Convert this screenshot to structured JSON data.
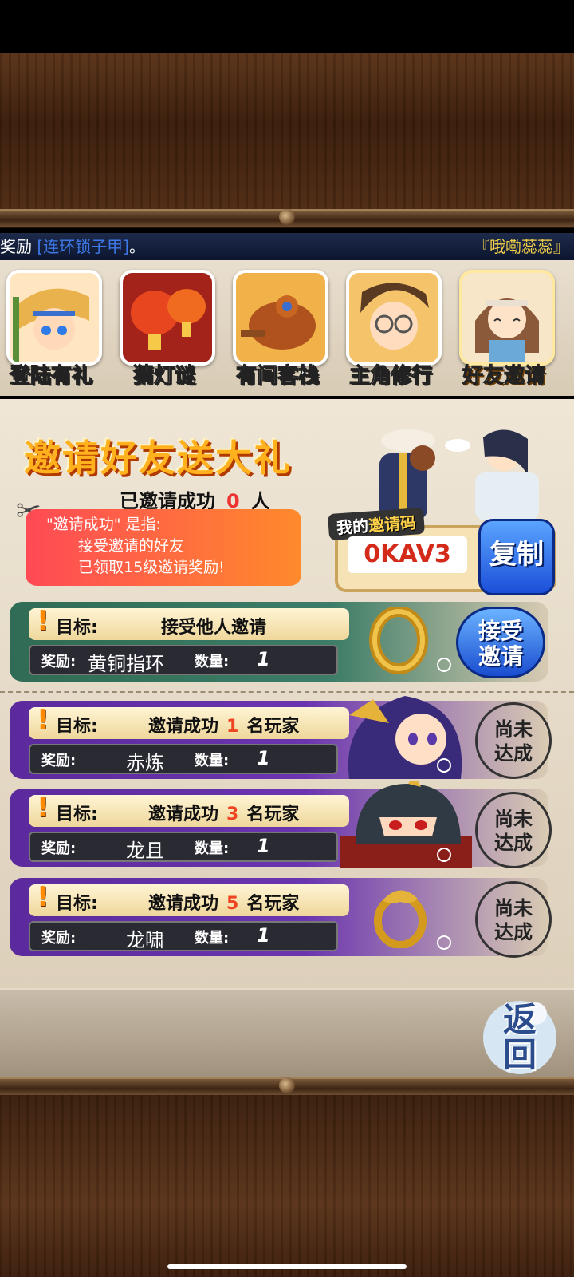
{
  "ticker": {
    "left": "奖励",
    "item": "[连环锁子甲]",
    "end": "。",
    "right": "『哦嘞蕊蕊』"
  },
  "tabs": [
    {
      "label": "登陆有礼",
      "icon": "hero-avatar-icon"
    },
    {
      "label": "猜灯谜",
      "icon": "lantern-icon"
    },
    {
      "label": "有间客栈",
      "icon": "roast-chicken-icon"
    },
    {
      "label": "主角修行",
      "icon": "glasses-boy-icon"
    },
    {
      "label": "好友邀请",
      "icon": "girl-avatar-icon",
      "active": true
    }
  ],
  "invite": {
    "headline": "邀请好友送大礼",
    "success_prefix": "已邀请成功",
    "success_count": "0",
    "success_suffix": "人",
    "note_line1": "\"邀请成功\" 是指:",
    "note_line2": "接受邀请的好友",
    "note_line3": "已领取15级邀请奖励!",
    "code_label_a": "我的",
    "code_label_b": "邀请码",
    "code": "0KAV3",
    "copy_label": "复制"
  },
  "accept_task": {
    "goal_title": "目标:",
    "goal_desc": "接受他人邀请",
    "reward_title": "奖励:",
    "reward_name": "黄铜指环",
    "qty_title": "数量:",
    "qty": "1",
    "button_line1": "接受",
    "button_line2": "邀请"
  },
  "tasks": [
    {
      "goal_title": "目标:",
      "goal_prefix": "邀请成功",
      "goal_num": "1",
      "goal_suffix": "名玩家",
      "reward_title": "奖励:",
      "reward_name": "赤炼",
      "qty_title": "数量:",
      "qty": "1",
      "status_line1": "尚未",
      "status_line2": "达成"
    },
    {
      "goal_title": "目标:",
      "goal_prefix": "邀请成功",
      "goal_num": "3",
      "goal_suffix": "名玩家",
      "reward_title": "奖励:",
      "reward_name": "龙且",
      "qty_title": "数量:",
      "qty": "1",
      "status_line1": "尚未",
      "status_line2": "达成"
    },
    {
      "goal_title": "目标:",
      "goal_prefix": "邀请成功",
      "goal_num": "5",
      "goal_suffix": "名玩家",
      "reward_title": "奖励:",
      "reward_name": "龙啸",
      "qty_title": "数量:",
      "qty": "1",
      "status_line1": "尚未",
      "status_line2": "达成"
    }
  ],
  "back": {
    "line1": "返",
    "line2": "回"
  },
  "colors": {
    "accent_orange": "#ffb21e",
    "button_blue": "#1c4fd8",
    "purple_row": "#6b35b0",
    "green_row": "#3d7d67"
  }
}
